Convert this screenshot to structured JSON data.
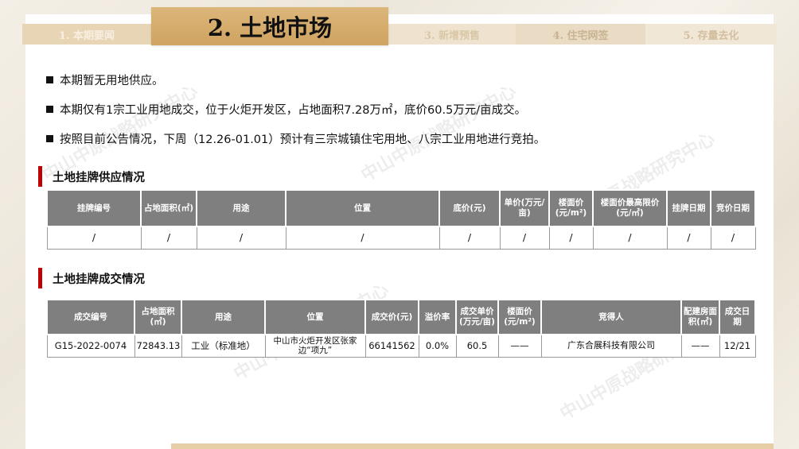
{
  "nav": {
    "tabs": [
      "1. 本期要闻",
      "2. 土地市场",
      "3. 新增预售",
      "4. 住宅网签",
      "5. 存量去化"
    ],
    "active": "2. 土地市场"
  },
  "bullets": [
    "本期暂无用地供应。",
    "本期仅有1宗工业用地成交，位于火炬开发区，占地面积7.28万㎡，底价60.5万元/亩成交。",
    "按照目前公告情况，下周（12.26-01.01）预计有三宗城镇住宅用地、八宗工业用地进行竞拍。"
  ],
  "supply": {
    "title": "土地挂牌供应情况",
    "headers": [
      "挂牌编号",
      "占地面积(㎡)",
      "用途",
      "位置",
      "底价(元)",
      "单价(万元/亩)",
      "楼面价(元/m²)",
      "楼面价最高限价(元/㎡)",
      "挂牌日期",
      "竞价日期"
    ],
    "row": [
      "/",
      "/",
      "/",
      "/",
      "/",
      "/",
      "/",
      "/",
      "/",
      "/"
    ]
  },
  "deal": {
    "title": "土地挂牌成交情况",
    "headers": [
      "成交编号",
      "占地面积(㎡)",
      "用途",
      "位置",
      "成交价(元)",
      "溢价率",
      "成交单价(万元/亩)",
      "楼面价(元/m²)",
      "竞得人",
      "配建房面积(㎡)",
      "成交日期"
    ],
    "row": [
      "G15-2022-0074",
      "72843.13",
      "工业（标准地）",
      "中山市火炬开发区张家边“项九”",
      "66141562",
      "0.0%",
      "60.5",
      "——",
      "广东合展科技有限公司",
      "——",
      "12/21"
    ]
  },
  "watermark": "中山中原战略研究中心",
  "colors": {
    "accent": "#c00000",
    "gold": "#d4ac6b",
    "header_gray": "#7f7f7f"
  }
}
